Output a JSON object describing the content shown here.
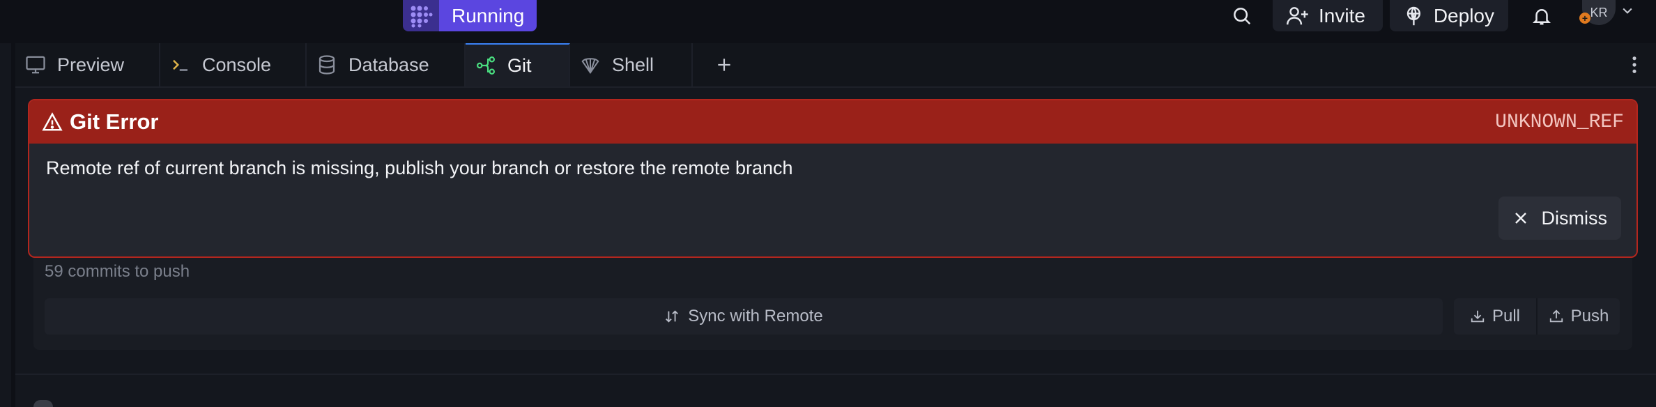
{
  "topbar": {
    "run_label": "Running",
    "invite_label": "Invite",
    "deploy_label": "Deploy",
    "avatar_initials": "KR",
    "accent": "#5b46e0"
  },
  "tabs": [
    {
      "label": "Preview",
      "icon": "monitor-icon"
    },
    {
      "label": "Console",
      "icon": "terminal-prompt-icon"
    },
    {
      "label": "Database",
      "icon": "database-icon"
    },
    {
      "label": "Git",
      "icon": "git-branch-icon",
      "active": true
    },
    {
      "label": "Shell",
      "icon": "shell-icon"
    }
  ],
  "error": {
    "title": "Git Error",
    "code": "UNKNOWN_REF",
    "message": "Remote ref of current branch is missing, publish your branch or restore the remote branch",
    "dismiss_label": "Dismiss",
    "color": "#9a2119"
  },
  "git": {
    "commits_text": "59 commits to push",
    "sync_label": "Sync with Remote",
    "pull_label": "Pull",
    "push_label": "Push"
  }
}
